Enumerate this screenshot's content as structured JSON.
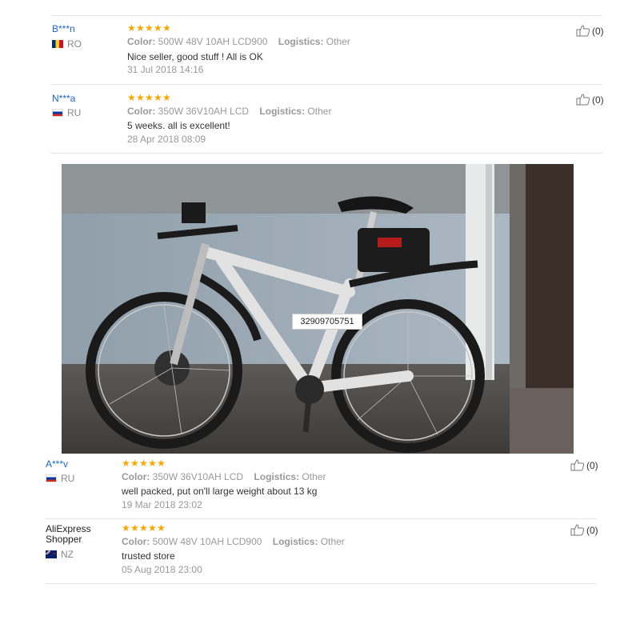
{
  "reviews": [
    {
      "user": "B***n",
      "country": "RO",
      "color_label": "Color:",
      "color_value": "500W 48V 10AH LCD900",
      "logistics_label": "Logistics:",
      "logistics_value": "Other",
      "text": "Nice seller, good stuff ! All is OK",
      "date": "31 Jul 2018 14:16",
      "helpful": "(0)",
      "rating": 5
    },
    {
      "user": "N***a",
      "country": "RU",
      "color_label": "Color:",
      "color_value": "350W 36V10AH LCD",
      "logistics_label": "Logistics:",
      "logistics_value": "Other",
      "text": "5 weeks. all is excellent!",
      "date": "28 Apr 2018 08:09",
      "helpful": "(0)",
      "rating": 5
    },
    {
      "user": "A***v",
      "country": "RU",
      "color_label": "Color:",
      "color_value": "350W 36V10AH LCD",
      "logistics_label": "Logistics:",
      "logistics_value": "Other",
      "text": "well packed, put on'll large weight about 13 kg",
      "date": "19 Mar 2018 23:02",
      "helpful": "(0)",
      "rating": 5
    },
    {
      "user_line1": "AliExpress",
      "user_line2": "Shopper",
      "country": "NZ",
      "color_label": "Color:",
      "color_value": "500W 48V 10AH LCD900",
      "logistics_label": "Logistics:",
      "logistics_value": "Other",
      "text": "trusted store",
      "date": "05 Aug 2018 23:00",
      "helpful": "(0)",
      "rating": 5
    }
  ],
  "photo": {
    "overlay_text": "32909705751"
  },
  "colors": {
    "username": "#1f66c1",
    "star": "#f7a700",
    "muted": "#999999"
  }
}
